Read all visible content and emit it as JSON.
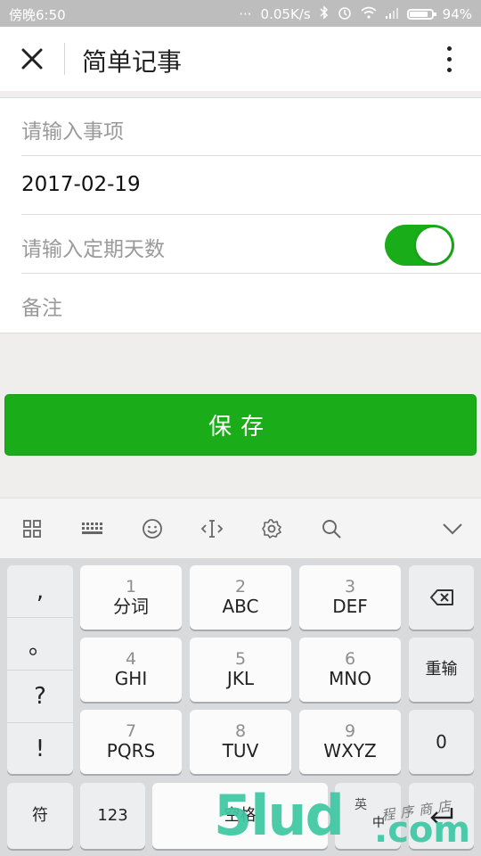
{
  "status_bar": {
    "time": "傍晚6:50",
    "signal_dots": "···",
    "network_speed": "0.05K/s",
    "battery": "94%",
    "battery_level": 0.94
  },
  "nav": {
    "title": "简单记事"
  },
  "form": {
    "item_placeholder": "请输入事项",
    "date_value": "2017-02-19",
    "period_placeholder": "请输入定期天数",
    "period_toggle_on": true,
    "note_placeholder": "备注"
  },
  "save_button": {
    "label": "保存"
  },
  "keyboard": {
    "punct": [
      ",",
      "。",
      "?",
      "!"
    ],
    "keys": [
      {
        "num": "1",
        "label": "分词"
      },
      {
        "num": "2",
        "label": "ABC"
      },
      {
        "num": "3",
        "label": "DEF"
      },
      {
        "num": "4",
        "label": "GHI"
      },
      {
        "num": "5",
        "label": "JKL"
      },
      {
        "num": "6",
        "label": "MNO"
      },
      {
        "num": "7",
        "label": "PQRS"
      },
      {
        "num": "8",
        "label": "TUV"
      },
      {
        "num": "9",
        "label": "WXYZ"
      }
    ],
    "retype": "重输",
    "zero": "0",
    "symbol": "符",
    "digits": "123",
    "space": "空格",
    "lang_en": "英",
    "lang_zh": "中"
  },
  "watermark": {
    "brand": "5lud",
    "tld": ".com",
    "sub": "程序商店"
  },
  "colors": {
    "accent": "#1aad19",
    "statusbar": "#bdbdbd",
    "keyboard_bg": "#d8dadc"
  },
  "icons": [
    "close-icon",
    "more-vertical-icon",
    "grid-icon",
    "keyboard-icon",
    "emoji-icon",
    "cursor-icon",
    "gear-icon",
    "search-icon",
    "chevron-down-icon",
    "backspace-icon",
    "enter-icon",
    "bluetooth-icon",
    "alarm-icon",
    "wifi-icon",
    "signal-icon"
  ]
}
